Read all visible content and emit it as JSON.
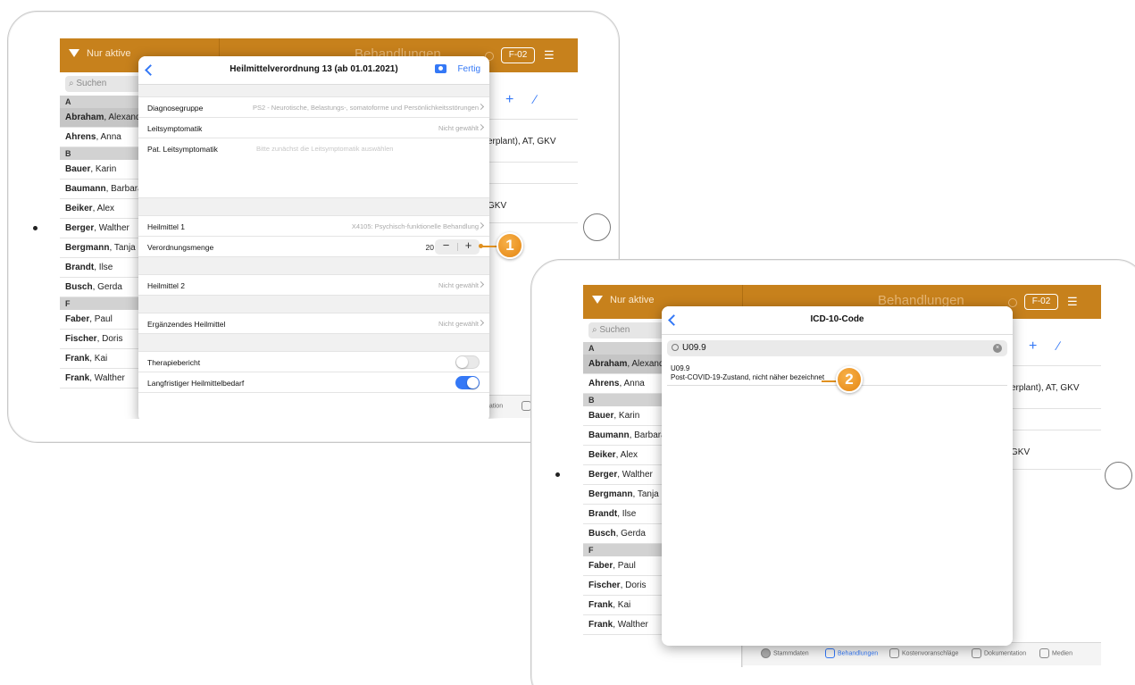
{
  "colors": {
    "brand": "#c7811c",
    "accent": "#3478f6",
    "callout": "#e58612"
  },
  "app": {
    "filter_label": "Nur aktive",
    "list_title": "Behandlungen",
    "room_label": "F-02",
    "search_placeholder": "Suchen",
    "add_icon": "plus-icon",
    "edit_icon": "pencil-icon",
    "sections": [
      {
        "letter": "A",
        "people": [
          {
            "last": "Abraham",
            "first": ", Alexander"
          },
          {
            "last": "Ahrens",
            "first": ", Anna"
          }
        ]
      },
      {
        "letter": "B",
        "people": [
          {
            "last": "Bauer",
            "first": ", Karin"
          },
          {
            "last": "Baumann",
            "first": ", Barbara"
          },
          {
            "last": "Beiker",
            "first": ", Alex"
          },
          {
            "last": "Berger",
            "first": ", Walther"
          },
          {
            "last": "Bergmann",
            "first": ", Tanja"
          },
          {
            "last": "Brandt",
            "first": ", Ilse"
          },
          {
            "last": "Busch",
            "first": ", Gerda"
          }
        ]
      },
      {
        "letter": "F",
        "people": [
          {
            "last": "Faber",
            "first": ", Paul"
          },
          {
            "last": "Fischer",
            "first": ", Doris"
          },
          {
            "last": "Frank",
            "first": ", Kai"
          },
          {
            "last": "Frank",
            "first": ", Walther"
          }
        ]
      }
    ],
    "detail_lines": [
      "erplant), AT, GKV",
      "GKV"
    ],
    "tabs": [
      "Stammdaten",
      "Behandlungen",
      "Kostenvoranschläge",
      "Dokumentation",
      "Medien"
    ]
  },
  "prescription_modal": {
    "title": "Heilmittelverordnung 13 (ab 01.01.2021)",
    "done_label": "Fertig",
    "diagnose_label": "Diagnosegruppe",
    "diagnose_value": "PS2 - Neurotische, Belastungs-, somatoforme und Persönlichkeitsstörungen",
    "leitsymptomatik_label": "Leitsymptomatik",
    "not_selected": "Nicht gewählt",
    "pat_leitsymptomatik_label": "Pat. Leitsymptomatik",
    "pat_leitsymptomatik_placeholder": "Bitte zunächst die Leitsymptomatik auswählen",
    "heilmittel1_label": "Heilmittel 1",
    "heilmittel1_value": "X4105: Psychisch-funktionelle Behandlung",
    "menge_label": "Verordnungsmenge",
    "menge_value": "20",
    "minus": "−",
    "plus": "+",
    "heilmittel2_label": "Heilmittel 2",
    "ergaenzend_label": "Ergänzendes Heilmittel",
    "therapiebericht_label": "Therapiebericht",
    "therapiebericht_on": false,
    "langfristig_label": "Langfristiger Heilmittelbedarf",
    "langfristig_on": true
  },
  "icd_modal": {
    "title": "ICD-10-Code",
    "search_value": "U09.9",
    "result_code": "U09.9",
    "result_desc": "Post-COVID-19-Zustand, nicht näher bezeichnet"
  },
  "callouts": {
    "one": "1",
    "two": "2"
  }
}
